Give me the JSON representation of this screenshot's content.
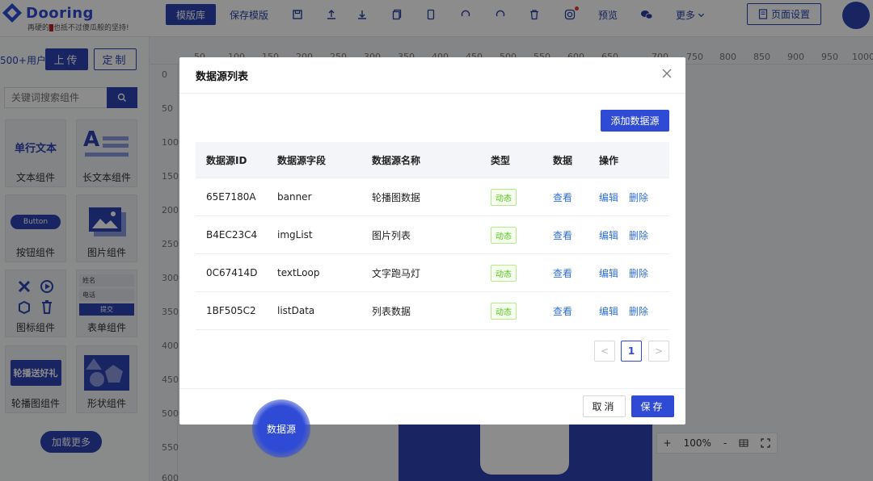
{
  "header": {
    "logo_name": "Dooring",
    "slogan_left": "再硬的",
    "slogan_right": "也抵不过傻瓜般的坚持!",
    "toolbar": {
      "template_lib": "模版库",
      "save_template": "保存模版",
      "preview": "预览",
      "more": "更多",
      "page_settings": "页面设置"
    }
  },
  "left": {
    "users_text": "500+用户",
    "upload_label": "上传",
    "custom_label": "定制",
    "search_placeholder": "关键词搜索组件",
    "components": [
      {
        "label": "文本组件",
        "preview": "单行文本"
      },
      {
        "label": "长文本组件"
      },
      {
        "label": "按钮组件",
        "preview": "Button"
      },
      {
        "label": "图片组件"
      },
      {
        "label": "图标组件"
      },
      {
        "label": "表单组件",
        "form_name": "姓名",
        "form_phone": "电话",
        "form_submit": "提交"
      },
      {
        "label": "轮播图组件",
        "preview": "轮播送好礼"
      },
      {
        "label": "形状组件"
      }
    ],
    "load_more": "加载更多"
  },
  "canvas": {
    "ruler_h": [
      "100",
      "150",
      "200",
      "250",
      "300",
      "350",
      "400",
      "450",
      "500",
      "550",
      "600",
      "650",
      "700",
      "750",
      "800",
      "850",
      "900",
      "950",
      "1000"
    ],
    "ruler_h_first": "50",
    "ruler_v": [
      "0",
      "50",
      "100",
      "150",
      "200",
      "250",
      "300",
      "350",
      "400",
      "450",
      "500",
      "550",
      "600"
    ],
    "zoom_in": "+",
    "zoom_value": "100%",
    "zoom_out": "-"
  },
  "modal": {
    "title": "数据源列表",
    "add_button": "添加数据源",
    "columns": [
      "数据源ID",
      "数据源字段",
      "数据源名称",
      "类型",
      "数据",
      "操作"
    ],
    "rows": [
      {
        "id": "65E7180A",
        "field": "banner",
        "name": "轮播图数据",
        "type": "动态",
        "data": "查看",
        "edit": "编辑",
        "delete": "删除"
      },
      {
        "id": "B4EC23C4",
        "field": "imgList",
        "name": "图片列表",
        "type": "动态",
        "data": "查看",
        "edit": "编辑",
        "delete": "删除"
      },
      {
        "id": "0C67414D",
        "field": "textLoop",
        "name": "文字跑马灯",
        "type": "动态",
        "data": "查看",
        "edit": "编辑",
        "delete": "删除"
      },
      {
        "id": "1BF505C2",
        "field": "listData",
        "name": "列表数据",
        "type": "动态",
        "data": "查看",
        "edit": "编辑",
        "delete": "删除"
      }
    ],
    "pagination": {
      "prev": "<",
      "current": "1",
      "next": ">"
    },
    "cancel": "取消",
    "save": "保存"
  },
  "float_button": "数据源",
  "colors": {
    "brand": "#2f4bd6",
    "tag_green": "#52c41a",
    "link": "#2f6fd6"
  }
}
